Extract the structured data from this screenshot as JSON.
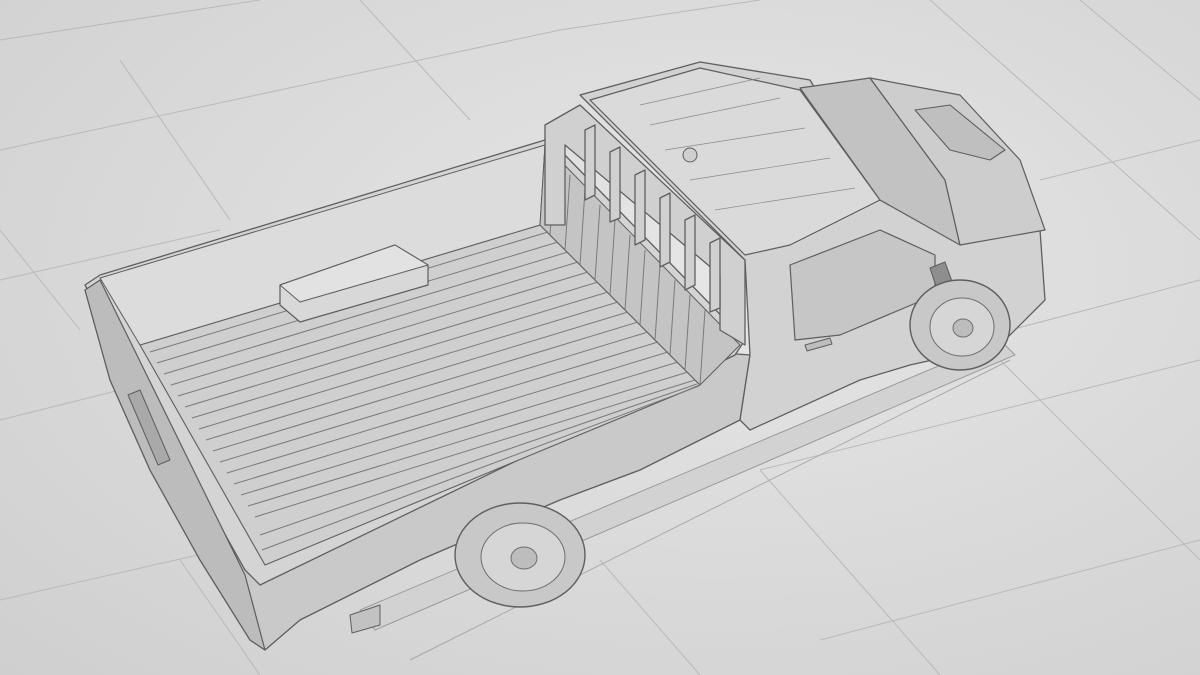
{
  "viewport": {
    "background": "#dcdcdc",
    "grid_color": "#b9b9b9",
    "line_color": "#5e5e5e",
    "surface_color": "#cfcfcf"
  },
  "scene": {
    "subject": "pickup-truck-wireframe-render",
    "icons": [
      "truck-icon"
    ]
  }
}
